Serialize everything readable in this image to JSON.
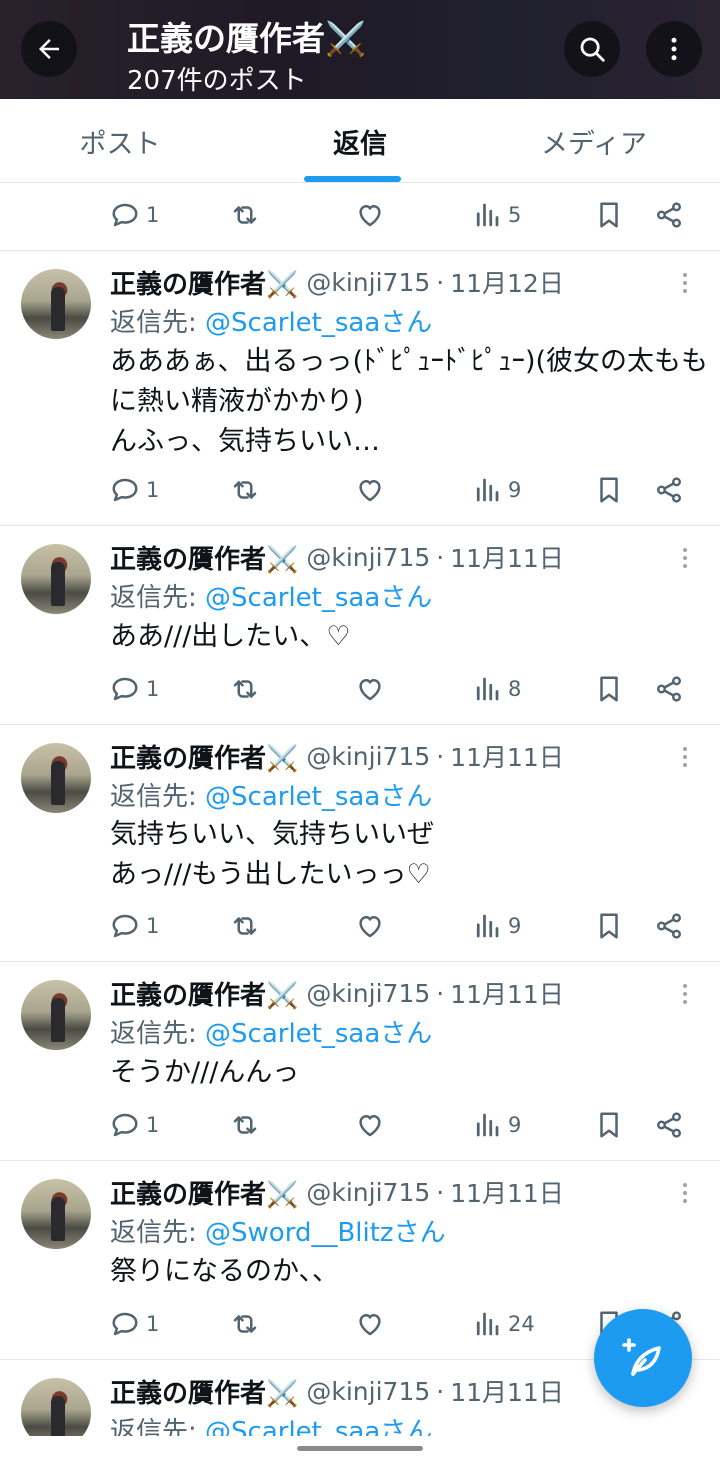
{
  "header": {
    "title": "正義の贋作者⚔️",
    "subtitle": "207件のポスト"
  },
  "tabs": [
    {
      "label": "ポスト",
      "active": false
    },
    {
      "label": "返信",
      "active": true
    },
    {
      "label": "メディア",
      "active": false
    }
  ],
  "top_actions": {
    "replies": "1",
    "views": "5"
  },
  "tweets": [
    {
      "name": "正義の贋作者⚔️",
      "handle": "@kinji715",
      "sep": "·",
      "date": "11月12日",
      "reply_prefix": "返信先: ",
      "reply_to": "@Scarlet_saaさん",
      "lines": [
        "あああぁ、出るっっ(ﾄﾞﾋﾟｭｰﾄﾞﾋﾟｭｰ)(彼女の太もも",
        "に熱い精液がかかり)",
        "んふっ、気持ちいい…"
      ],
      "replies": "1",
      "views": "9"
    },
    {
      "name": "正義の贋作者⚔️",
      "handle": "@kinji715",
      "sep": "·",
      "date": "11月11日",
      "reply_prefix": "返信先: ",
      "reply_to": "@Scarlet_saaさん",
      "lines": [
        "ああ///出したい、♡"
      ],
      "replies": "1",
      "views": "8"
    },
    {
      "name": "正義の贋作者⚔️",
      "handle": "@kinji715",
      "sep": "·",
      "date": "11月11日",
      "reply_prefix": "返信先: ",
      "reply_to": "@Scarlet_saaさん",
      "lines": [
        "気持ちいい、気持ちいいぜ",
        "あっ///もう出したいっっ♡"
      ],
      "replies": "1",
      "views": "9"
    },
    {
      "name": "正義の贋作者⚔️",
      "handle": "@kinji715",
      "sep": "·",
      "date": "11月11日",
      "reply_prefix": "返信先: ",
      "reply_to": "@Scarlet_saaさん",
      "lines": [
        "そうか///んんっ"
      ],
      "replies": "1",
      "views": "9"
    },
    {
      "name": "正義の贋作者⚔️",
      "handle": "@kinji715",
      "sep": "·",
      "date": "11月11日",
      "reply_prefix": "返信先: ",
      "reply_to": "@Sword__Blitzさん",
      "lines": [
        "祭りになるのか、、"
      ],
      "replies": "1",
      "views": "24"
    },
    {
      "name": "正義の贋作者⚔️",
      "handle": "@kinji715",
      "sep": "·",
      "date": "11月11日",
      "reply_prefix": "返信先: ",
      "reply_to": "@Scarlet_saaさん",
      "lines": [],
      "replies": "",
      "views": ""
    }
  ],
  "icons": {
    "back": "arrow-left-icon",
    "search": "search-icon",
    "more": "more-vertical-icon",
    "reply": "reply-icon",
    "retweet": "retweet-icon",
    "like": "heart-icon",
    "views": "views-icon",
    "bookmark": "bookmark-icon",
    "share": "share-icon",
    "compose": "compose-icon"
  },
  "colors": {
    "accent": "#1d9bf0",
    "text": "#0f1419",
    "muted": "#536471"
  }
}
